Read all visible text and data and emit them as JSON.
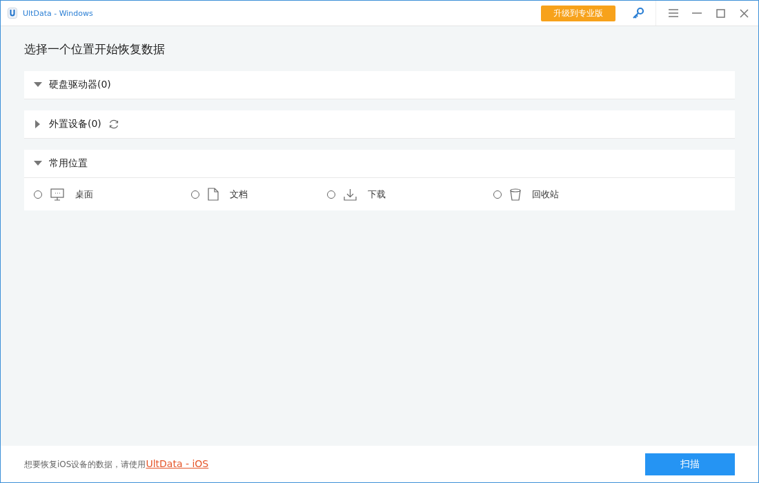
{
  "window": {
    "title": "UltData - Windows",
    "upgrade_button": "升级到专业版"
  },
  "heading": "选择一个位置开始恢复数据",
  "sections": [
    {
      "label": "硬盘驱动器(0)",
      "expanded": true,
      "refresh": false
    },
    {
      "label": "外置设备(0)",
      "expanded": false,
      "refresh": true
    },
    {
      "label": "常用位置",
      "expanded": true,
      "refresh": false,
      "items": [
        {
          "label": "桌面",
          "selected": false
        },
        {
          "label": "文档",
          "selected": false
        },
        {
          "label": "下载",
          "selected": false
        },
        {
          "label": "回收站",
          "selected": false
        }
      ]
    }
  ],
  "footer": {
    "text": "想要恢复iOS设备的数据，请使用",
    "link": "UltData - iOS",
    "button": "扫描"
  }
}
